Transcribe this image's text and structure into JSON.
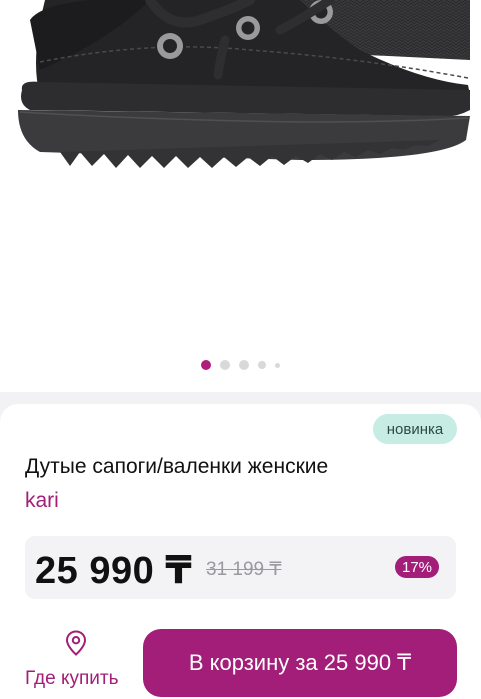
{
  "gallery": {
    "image_alt": "",
    "slide_count": 5,
    "active_slide": 1
  },
  "product": {
    "badge": "новинка",
    "title": "Дутые сапоги/валенки женские",
    "brand": "kari"
  },
  "pricing": {
    "price": "25 990 ₸",
    "old_price": "31 199 ₸",
    "discount": "17%"
  },
  "actions": {
    "where_to_buy": "Где купить",
    "add_to_cart": "В корзину за 25 990 ₸"
  },
  "colors": {
    "accent": "#a21e79",
    "badge_bg": "#c6ece4"
  },
  "icons": {
    "where_to_buy": "location-pin-icon"
  }
}
